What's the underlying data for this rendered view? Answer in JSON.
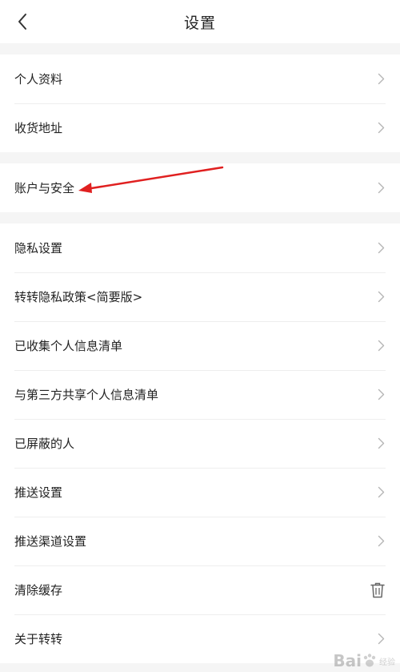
{
  "header": {
    "title": "设置",
    "back_icon": "chevron-left-icon"
  },
  "groups": [
    {
      "items": [
        {
          "label": "个人资料",
          "trailing_icon": "chevron-right-icon"
        },
        {
          "label": "收货地址",
          "trailing_icon": "chevron-right-icon"
        }
      ]
    },
    {
      "items": [
        {
          "label": "账户与安全",
          "trailing_icon": "chevron-right-icon"
        }
      ]
    },
    {
      "items": [
        {
          "label": "隐私设置",
          "trailing_icon": "chevron-right-icon"
        },
        {
          "label": "转转隐私政策<简要版>",
          "trailing_icon": "chevron-right-icon"
        },
        {
          "label": "已收集个人信息清单",
          "trailing_icon": "chevron-right-icon"
        },
        {
          "label": "与第三方共享个人信息清单",
          "trailing_icon": "chevron-right-icon"
        },
        {
          "label": "已屏蔽的人",
          "trailing_icon": "chevron-right-icon"
        },
        {
          "label": "推送设置",
          "trailing_icon": "chevron-right-icon"
        },
        {
          "label": "推送渠道设置",
          "trailing_icon": "chevron-right-icon"
        },
        {
          "label": "清除缓存",
          "trailing_icon": "trash-icon"
        },
        {
          "label": "关于转转",
          "trailing_icon": "chevron-right-icon"
        }
      ]
    }
  ],
  "annotation": {
    "color": "#e02020",
    "target": "账户与安全"
  },
  "watermark": {
    "text": "Bai",
    "sub": "经验"
  },
  "colors": {
    "background": "#f5f5f5",
    "surface": "#ffffff",
    "text": "#222222",
    "chevron": "#b5b5b5",
    "divider": "#eeeeee"
  }
}
